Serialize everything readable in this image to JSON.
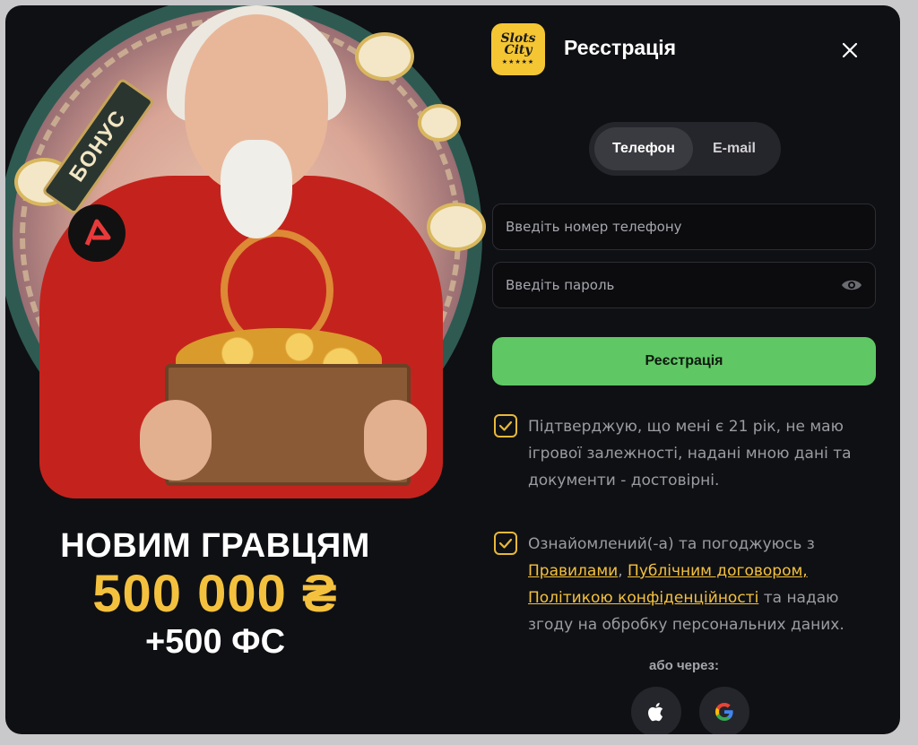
{
  "promo": {
    "badge_text": "БОНУС",
    "line1": "НОВИМ ГРАВЦЯМ",
    "line2": "500 000 ₴",
    "line3": "+500 ФС"
  },
  "logo": {
    "line1": "Slots",
    "line2": "City",
    "stars": "★★★★★"
  },
  "header": {
    "title": "Реєстрація"
  },
  "tabs": [
    {
      "label": "Телефон",
      "active": true
    },
    {
      "label": "E-mail",
      "active": false
    }
  ],
  "form": {
    "phone_placeholder": "Введіть номер телефону",
    "password_placeholder": "Введіть пароль",
    "submit_label": "Реєстрація"
  },
  "consents": {
    "age": {
      "checked": true,
      "text": "Підтверджую, що мені є 21 рік, не маю ігрової залежності, надані мною дані та документи - достовірні."
    },
    "terms": {
      "checked": true,
      "prefix": "Ознайомлений(-а) та погоджуюсь з ",
      "link_rules": "Правилами",
      "sep1": ", ",
      "link_offer": "Публічним договором,",
      "sep2": " ",
      "link_privacy": "Політикою конфіденційності",
      "suffix": " та надаю згоду на обробку персональних даних."
    }
  },
  "social": {
    "label": "або через:",
    "providers": [
      "apple-icon",
      "google-icon"
    ]
  },
  "colors": {
    "accent_green": "#5fc864",
    "accent_yellow": "#f4c13f",
    "background": "#0f1013"
  }
}
